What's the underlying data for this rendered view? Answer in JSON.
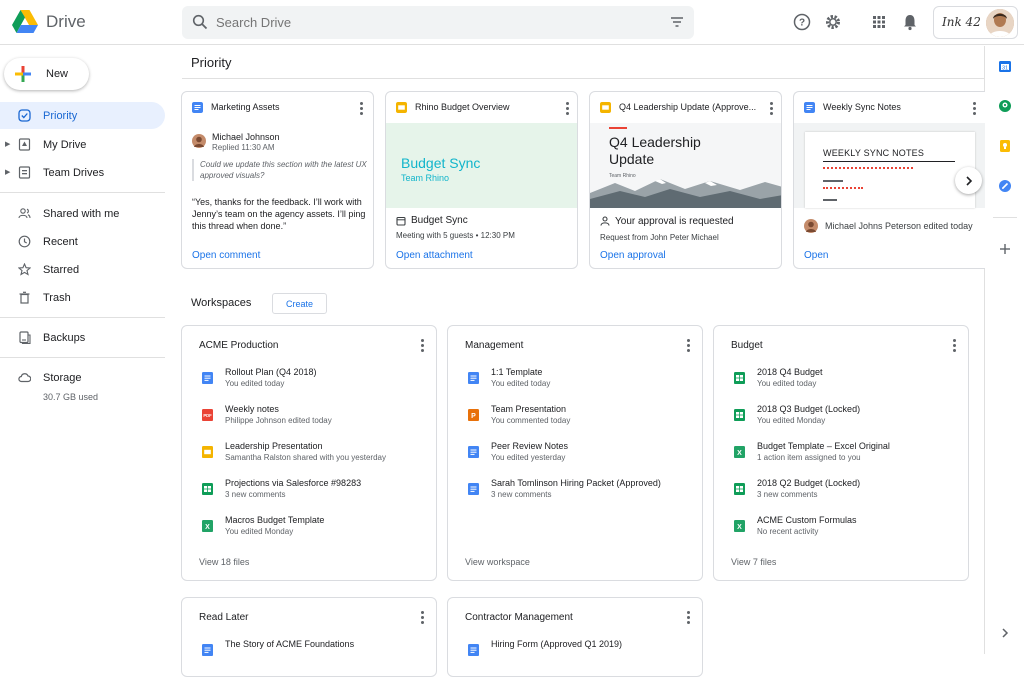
{
  "app": {
    "title": "Drive"
  },
  "search": {
    "placeholder": "Search Drive"
  },
  "account": {
    "signature": "Ink 42"
  },
  "sidebar": {
    "new_label": "New",
    "items": [
      {
        "label": "Priority",
        "icon": "check-circle-icon"
      },
      {
        "label": "My Drive",
        "icon": "drive-icon"
      },
      {
        "label": "Team Drives",
        "icon": "team-drive-icon"
      },
      {
        "label": "Shared with me",
        "icon": "people-icon"
      },
      {
        "label": "Recent",
        "icon": "clock-icon"
      },
      {
        "label": "Starred",
        "icon": "star-icon"
      },
      {
        "label": "Trash",
        "icon": "trash-icon"
      },
      {
        "label": "Backups",
        "icon": "backup-icon"
      },
      {
        "label": "Storage",
        "icon": "cloud-icon"
      }
    ],
    "storage_used": "30.7 GB used"
  },
  "priority": {
    "title": "Priority",
    "cards": [
      {
        "title": "Marketing Assets",
        "type": "doc",
        "author": "Michael Johnson",
        "time": "Replied 11:30 AM",
        "quote": "Could we update this section with the latest UX approved visuals?",
        "reply": "“Yes, thanks for the feedback. I’ll work with Jenny’s team on the agency assets. I’ll ping this thread when done.”",
        "link": "Open comment"
      },
      {
        "title": "Rhino Budget Overview",
        "type": "slides",
        "preview_title": "Budget Sync",
        "preview_sub": "Team Rhino",
        "event_title": "Budget Sync",
        "event_detail": "Meeting with 5 guests • 12:30 PM",
        "link": "Open attachment"
      },
      {
        "title": "Q4 Leadership Update (Approve...",
        "type": "slides",
        "preview_title": "Q4 Leadership Update",
        "preview_sub": "Team Rhino",
        "approval_title": "Your approval is requested",
        "approval_detail": "Request from John Peter Michael",
        "link": "Open approval"
      },
      {
        "title": "Weekly Sync Notes",
        "type": "doc",
        "preview_title": "WEEKLY SYNC NOTES",
        "editor": "Michael Johns Peterson edited today",
        "link": "Open"
      }
    ]
  },
  "workspaces": {
    "title": "Workspaces",
    "create_label": "Create",
    "cards": [
      {
        "title": "ACME Production",
        "files": [
          {
            "name": "Rollout Plan (Q4 2018)",
            "sub": "You edited today",
            "type": "doc"
          },
          {
            "name": "Weekly notes",
            "sub": "Philippe Johnson edited today",
            "type": "pdf"
          },
          {
            "name": "Leadership Presentation",
            "sub": "Samantha Ralston shared with you yesterday",
            "type": "slides"
          },
          {
            "name": "Projections via Salesforce #98283",
            "sub": "3 new comments",
            "type": "sheet"
          },
          {
            "name": "Macros Budget Template",
            "sub": "You edited Monday",
            "type": "excel"
          }
        ],
        "footer": "View 18 files"
      },
      {
        "title": "Management",
        "files": [
          {
            "name": "1:1 Template",
            "sub": "You edited today",
            "type": "doc"
          },
          {
            "name": "Team Presentation",
            "sub": "You commented today",
            "type": "ppt"
          },
          {
            "name": "Peer Review Notes",
            "sub": "You edited yesterday",
            "type": "doc"
          },
          {
            "name": "Sarah Tomlinson Hiring Packet (Approved)",
            "sub": "3 new comments",
            "type": "doc"
          }
        ],
        "footer": "View workspace"
      },
      {
        "title": "Budget",
        "files": [
          {
            "name": "2018 Q4 Budget",
            "sub": "You edited today",
            "type": "sheet"
          },
          {
            "name": "2018 Q3 Budget (Locked)",
            "sub": "You edited Monday",
            "type": "sheet"
          },
          {
            "name": "Budget Template – Excel Original",
            "sub": "1 action item assigned to you",
            "type": "excel"
          },
          {
            "name": "2018 Q2 Budget (Locked)",
            "sub": "3 new comments",
            "type": "sheet"
          },
          {
            "name": "ACME Custom Formulas",
            "sub": "No recent activity",
            "type": "excel"
          }
        ],
        "footer": "View 7 files"
      },
      {
        "title": "Read Later",
        "files": [
          {
            "name": "The Story of ACME Foundations",
            "sub": "",
            "type": "doc"
          }
        ],
        "footer": ""
      },
      {
        "title": "Contractor Management",
        "files": [
          {
            "name": "Hiring Form (Approved Q1 2019)",
            "sub": "",
            "type": "doc"
          }
        ],
        "footer": ""
      }
    ]
  },
  "colors": {
    "accent": "#1a73e8",
    "doc": "#4285f4",
    "sheet": "#0f9d58",
    "slides": "#f4b400",
    "pdf": "#ea4335",
    "ppt": "#e8710a",
    "excel": "#21a366"
  }
}
